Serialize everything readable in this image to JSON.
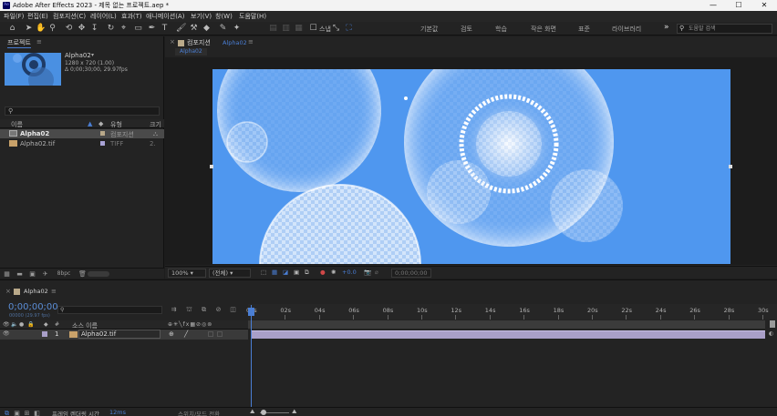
{
  "titlebar": {
    "app_icon": "Ae",
    "title": "Adobe After Effects 2023 - 제목 없는 프로젝트.aep *",
    "minimize": "—",
    "maximize": "☐",
    "close": "✕"
  },
  "menu": [
    "파일(F)",
    "편집(E)",
    "컴포지션(C)",
    "레이어(L)",
    "효과(T)",
    "애니메이션(A)",
    "보기(V)",
    "창(W)",
    "도움말(H)"
  ],
  "toolbar": {
    "snap_label": "스냅",
    "workspaces": [
      "기본값",
      "검토",
      "학습",
      "작은 화면",
      "표준",
      "라이브러리"
    ],
    "more": "»",
    "search_help_placeholder": "도움말 검색"
  },
  "project": {
    "tab_label": "프로젝트",
    "tab_menu": "≡",
    "item_name": "Alpha02",
    "item_name_arrow": "▾",
    "item_size": "1280 x 720 (1.00)",
    "item_duration": "Δ 0;00;30;00, 29.97fps",
    "columns": {
      "name": "이름",
      "type": "유형",
      "size": "크기"
    },
    "rows": [
      {
        "name": "Alpha02",
        "type": "컴포지션",
        "size": "",
        "selected": true
      },
      {
        "name": "Alpha02.tif",
        "type": "TIFF",
        "size": "2.",
        "selected": false
      }
    ],
    "bpc": "8bpc"
  },
  "composition": {
    "close": "×",
    "tab_label": "컴포지션",
    "tab_name": "Alpha02",
    "tab_menu": "≡",
    "subtab": "Alpha02",
    "zoom": "100%",
    "resolution": "(전체)",
    "exposure": "+0.0",
    "timecode": "0;00;00;00"
  },
  "timeline": {
    "close": "×",
    "tab_label": "Alpha02",
    "tab_menu": "≡",
    "timecode": "0;00;00;00",
    "timecode_sub": "00000 (29.97 fps)",
    "col_num": "#",
    "col_source": "소스 이름",
    "layer": {
      "index": "1",
      "name": "Alpha02.tif"
    },
    "ruler": [
      "00s",
      "02s",
      "04s",
      "06s",
      "08s",
      "10s",
      "12s",
      "14s",
      "16s",
      "18s",
      "20s",
      "22s",
      "24s",
      "26s",
      "28s",
      "30s"
    ],
    "render_label": "프레임 렌더링 시간",
    "render_value": "12ms",
    "toggle_label": "스위치/모드 전환"
  },
  "colors": {
    "accent": "#4a7ed4",
    "canvas": "#4f97ef",
    "layerbar": "#a99fc8"
  }
}
